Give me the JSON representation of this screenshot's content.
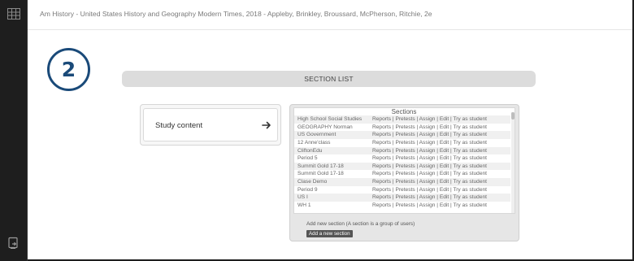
{
  "header": {
    "book_title": "Am History - United States History and Geography Modern Times, 2018 - Appleby, Brinkley, Broussard, McPherson, Ritchie, 2e"
  },
  "step": {
    "number": "2"
  },
  "section_list": {
    "title": "SECTION LIST"
  },
  "study": {
    "label": "Study content"
  },
  "sections": {
    "heading": "Sections",
    "rows": [
      {
        "name": "High School Social Studies",
        "actions": "Reports  |  Pretests  |  Assign  |  Edit  |  Try as student"
      },
      {
        "name": "GEOGRAPHY Norman",
        "actions": "Reports  |  Pretests  |  Assign  |  Edit  |  Try as student"
      },
      {
        "name": "US Government",
        "actions": "Reports  |  Pretests  |  Assign  |  Edit  |  Try as student"
      },
      {
        "name": "12 Anne'class",
        "actions": "Reports  |  Pretests  |  Assign  |  Edit  |  Try as student"
      },
      {
        "name": "CliftonEdu",
        "actions": "Reports  |  Pretests  |  Assign  |  Edit  |  Try as student"
      },
      {
        "name": "Period 5",
        "actions": "Reports  |  Pretests  |  Assign  |  Edit  |  Try as student"
      },
      {
        "name": "Summit Gold 17-18",
        "actions": "Reports  |  Pretests  |  Assign  |  Edit  |  Try as student"
      },
      {
        "name": "Summit Gold 17-18",
        "actions": "Reports  |  Pretests  |  Assign  |  Edit  |  Try as student"
      },
      {
        "name": "Clase Demo",
        "actions": "Reports  |  Pretests  |  Assign  |  Edit  |  Try as student"
      },
      {
        "name": "Period 9",
        "actions": "Reports  |  Pretests  |  Assign  |  Edit  |  Try as student"
      },
      {
        "name": "US I",
        "actions": "Reports  |  Pretests  |  Assign  |  Edit  |  Try as student"
      },
      {
        "name": "WH 1",
        "actions": "Reports  |  Pretests  |  Assign  |  Edit  |  Try as student"
      }
    ],
    "add_note": "Add new section (A section is a group of users)",
    "add_button": "Add a new section"
  },
  "icons": {
    "sidebar_top": "grid-icon",
    "sidebar_bottom": "exit-icon",
    "study_arrow": "arrow-right-icon"
  },
  "colors": {
    "badge": "#1a4a79",
    "frame": "#1e1e1e"
  }
}
